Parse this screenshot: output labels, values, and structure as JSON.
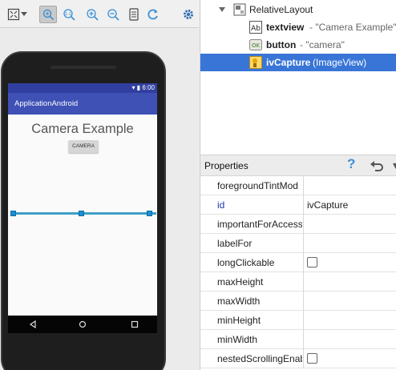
{
  "colors": {
    "status_bar": "#303f9f",
    "action_bar": "#3f51b5",
    "selection": "#3875d7",
    "selection_line": "#3f9fc6",
    "help_icon": "#3a8fd6"
  },
  "toolbar": {
    "icons": [
      "layout-icon",
      "dropdown-arrow-icon",
      "zoom-to-fit-icon",
      "actual-size-icon",
      "zoom-in-icon",
      "zoom-out-icon",
      "screenshot-icon",
      "refresh-icon",
      "settings-icon"
    ]
  },
  "device": {
    "status_time": "6:00",
    "app_title": "ApplicationAndroid",
    "textview_text": "Camera Example",
    "button_text": "CAMERA"
  },
  "component_tree": {
    "root": "RelativeLayout",
    "children": [
      {
        "id": "textview",
        "detail": "- \"Camera Example\""
      },
      {
        "id": "button",
        "detail": "- \"camera\""
      },
      {
        "id": "ivCapture",
        "detail": "(ImageView)"
      }
    ],
    "selected_index": 2
  },
  "properties": {
    "title": "Properties",
    "help": "?",
    "more": "▾",
    "rows": [
      {
        "name": "foregroundTintMod",
        "value": ""
      },
      {
        "name": "id",
        "value": "ivCapture"
      },
      {
        "name": "importantForAccess",
        "value": ""
      },
      {
        "name": "labelFor",
        "value": ""
      },
      {
        "name": "longClickable",
        "value": ""
      },
      {
        "name": "maxHeight",
        "value": ""
      },
      {
        "name": "maxWidth",
        "value": ""
      },
      {
        "name": "minHeight",
        "value": ""
      },
      {
        "name": "minWidth",
        "value": ""
      },
      {
        "name": "nestedScrollingEnab",
        "value": ""
      }
    ],
    "checkbox_rows": [
      "longClickable",
      "nestedScrollingEnab"
    ]
  }
}
